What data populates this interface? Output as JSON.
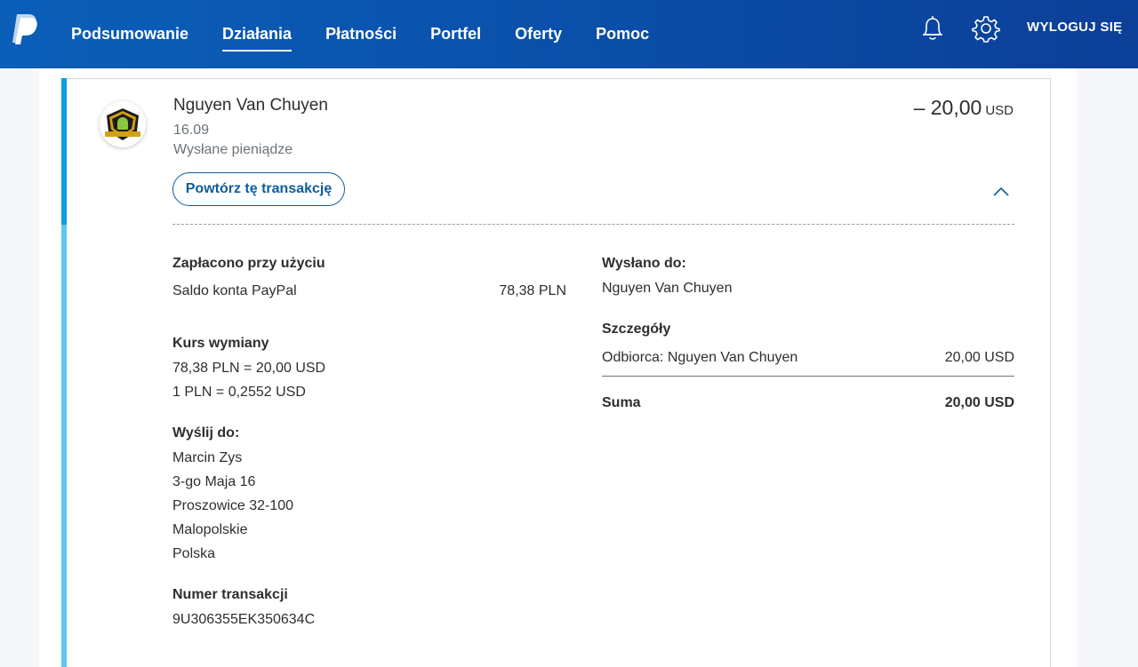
{
  "nav": {
    "items": [
      "Podsumowanie",
      "Działania",
      "Płatności",
      "Portfel",
      "Oferty",
      "Pomoc"
    ],
    "active_index": 1,
    "logout": "WYLOGUJ SIĘ",
    "icons": [
      "paypal-logo-icon",
      "bell-icon",
      "gear-icon"
    ]
  },
  "transaction": {
    "name": "Nguyen Van Chuyen",
    "date": "16.09",
    "type": "Wysłane pieniądze",
    "amount": "– 20,00",
    "currency": "USD",
    "repeat_label": "Powtórz tę transakcję"
  },
  "details": {
    "paid_with_label": "Zapłacono przy użyciu",
    "paid_with_source": "Saldo konta PayPal",
    "paid_with_amount": "78,38 PLN",
    "exchange_label": "Kurs wymiany",
    "exchange_line1": "78,38 PLN = 20,00 USD",
    "exchange_line2": "1 PLN = 0,2552 USD",
    "ship_to_label": "Wyślij do:",
    "ship_to": [
      "Marcin Zys",
      "3-go Maja 16",
      "Proszowice 32-100",
      "Malopolskie",
      "Polska"
    ],
    "txn_id_label": "Numer transakcji",
    "txn_id": "9U306355EK350634C",
    "sent_to_label": "Wysłano do:",
    "sent_to": "Nguyen Van Chuyen",
    "details_label": "Szczegóły",
    "recipient_line": "Odbiorca: Nguyen Van Chuyen",
    "recipient_amount": "20,00 USD",
    "total_label": "Suma",
    "total_amount": "20,00 USD"
  },
  "colors": {
    "header": "#0b5fb8",
    "accent": "#0c9ee3",
    "link": "#0e5d9e"
  }
}
